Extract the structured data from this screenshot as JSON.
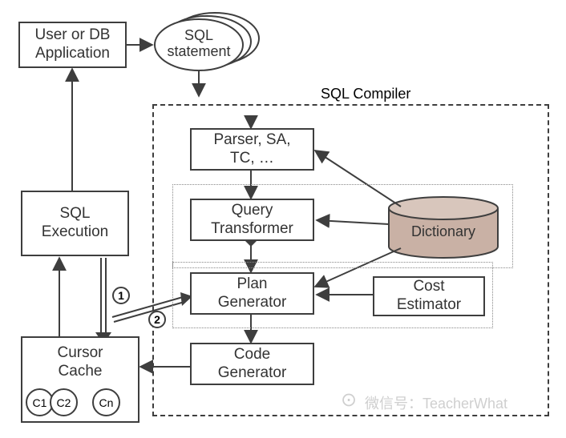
{
  "diagram": {
    "title": "SQL Compiler",
    "boxes": {
      "user_db": "User or DB\nApplication",
      "sql_statement": "SQL\nstatement",
      "sql_execution": "SQL\nExecution",
      "cursor_cache": "Cursor\nCache",
      "parser": "Parser, SA,\nTC, …",
      "query_transformer": "Query\nTransformer",
      "plan_generator": "Plan\nGenerator",
      "code_generator": "Code\nGenerator",
      "cost_estimator": "Cost\nEstimator",
      "dictionary": "Dictionary"
    },
    "circles": {
      "c1": "C1",
      "c2": "C2",
      "cn": "Cn"
    },
    "markers": {
      "one": "1",
      "two": "2"
    },
    "watermark": {
      "label": "微信号：TeacherWhat"
    }
  }
}
